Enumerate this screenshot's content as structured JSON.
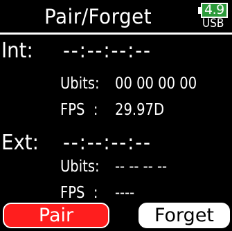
{
  "header": {
    "title": "Pair/Forget",
    "battery_level": "4.9",
    "power_source": "USB",
    "battery_color": "#2c9a3a"
  },
  "internal": {
    "label": "Int:",
    "timecode": "--:--:--:--",
    "ubits_label": "Ubits:",
    "ubits_value": "00 00 00 00",
    "fps_label": "FPS  :",
    "fps_value": "29.97D"
  },
  "external": {
    "label": "Ext:",
    "timecode": "--:--:--:--",
    "ubits_label": "Ubits:",
    "ubits_value": "-- -- -- --",
    "fps_label": "FPS  :",
    "fps_value": "----"
  },
  "buttons": {
    "pair_label": "Pair",
    "forget_label": "Forget",
    "pair_color": "#ff1e1e"
  }
}
